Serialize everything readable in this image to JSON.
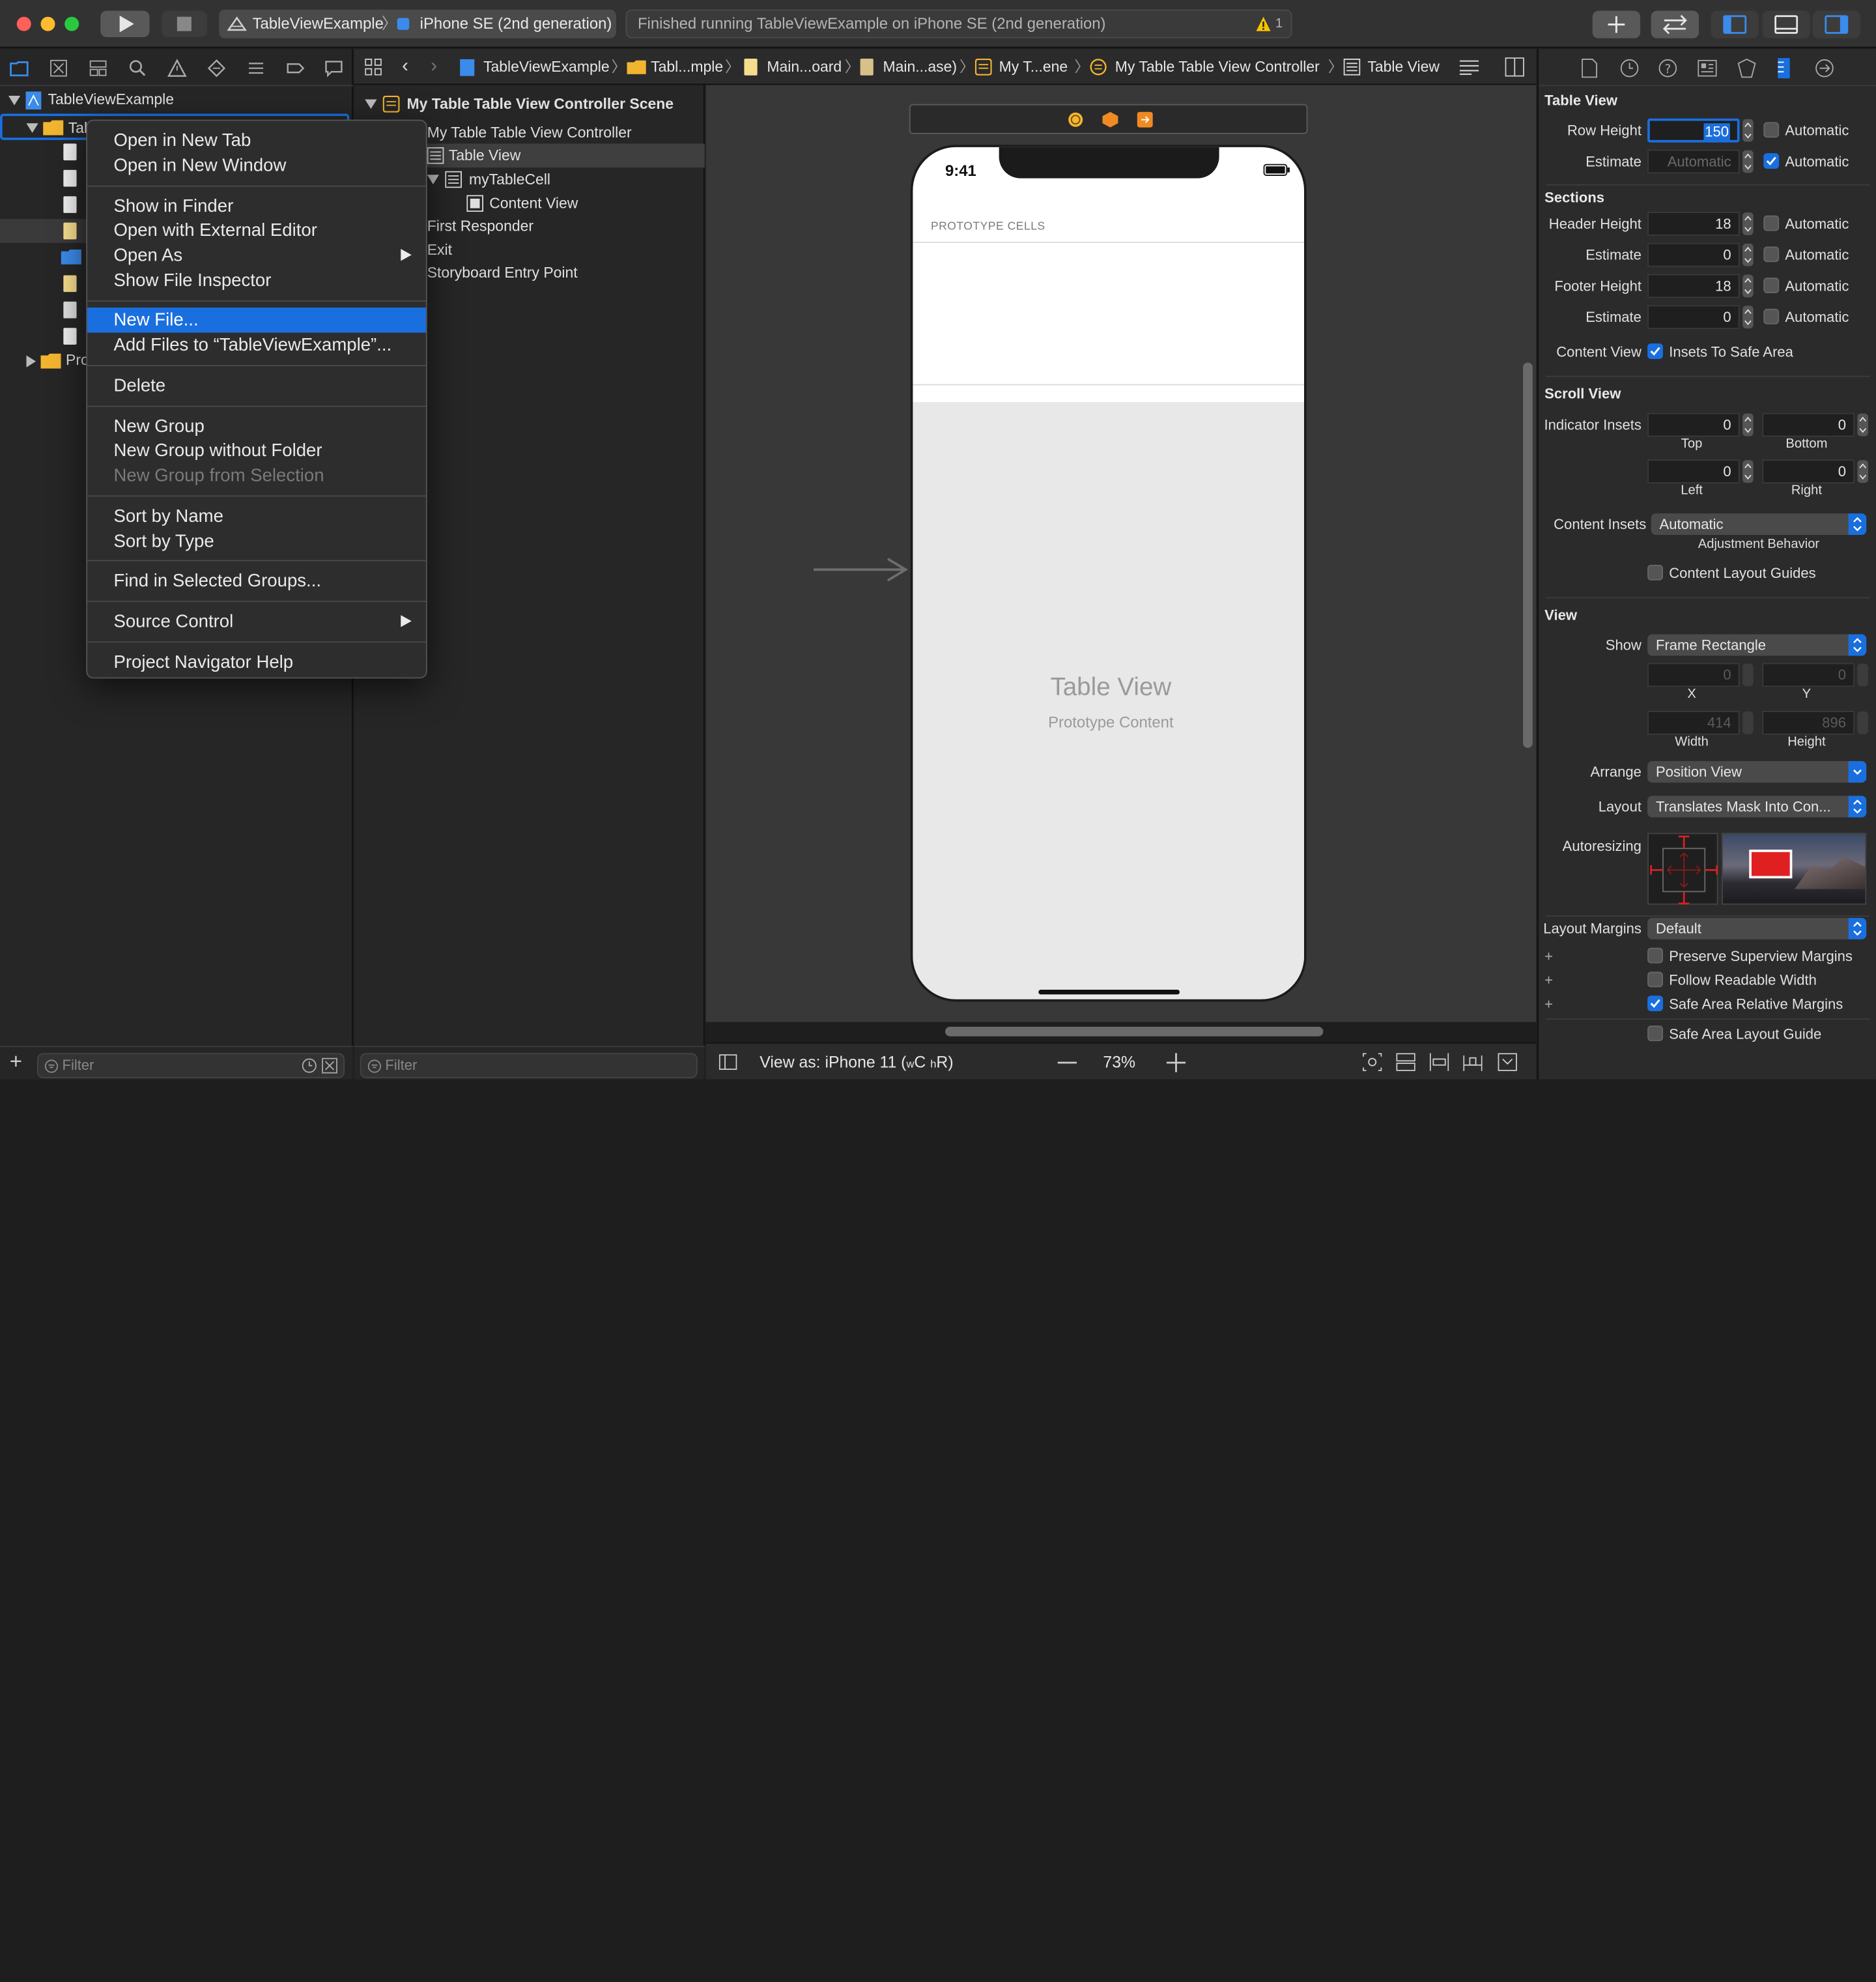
{
  "window": {
    "scheme_project": "TableViewExample",
    "scheme_device": "iPhone SE (2nd generation)",
    "activity_text": "Finished running TableViewExample on iPhone SE (2nd generation)",
    "warning_count": "1"
  },
  "navigator": {
    "project_name": "TableViewExample",
    "group_partial": "Tabl",
    "products_partial": "Pro",
    "filter_placeholder": "Filter"
  },
  "jumpbar": {
    "crumbs": [
      "TableViewExample",
      "Tabl...mple",
      "Main...oard",
      "Main...ase)",
      "My T...ene",
      "My Table Table View Controller",
      "Table View"
    ]
  },
  "outline": {
    "scene": "My Table Table View Controller Scene",
    "controller": "My Table Table View Controller",
    "table_view": "Table View",
    "cell": "myTableCell",
    "content_view": "Content View",
    "first_responder": "First Responder",
    "exit": "Exit",
    "entry_point": "Storyboard Entry Point",
    "filter_placeholder": "Filter"
  },
  "canvas": {
    "status_time": "9:41",
    "prototype_cells": "PROTOTYPE CELLS",
    "table_view_title": "Table View",
    "prototype_content": "Prototype Content"
  },
  "bottombar": {
    "view_as": "View as: iPhone 11 (",
    "size_w": "w",
    "size_c": "C",
    "size_h": "h",
    "size_r": "R)",
    "zoom": "73%"
  },
  "context_menu": {
    "groups": [
      [
        {
          "label": "Open in New Tab"
        },
        {
          "label": "Open in New Window"
        }
      ],
      [
        {
          "label": "Show in Finder"
        },
        {
          "label": "Open with External Editor"
        },
        {
          "label": "Open As"
        },
        {
          "label": "Show File Inspector"
        }
      ],
      [
        {
          "label": "New File..."
        },
        {
          "label": "Add Files to “TableViewExample”..."
        }
      ],
      [
        {
          "label": "Delete"
        }
      ],
      [
        {
          "label": "New Group"
        },
        {
          "label": "New Group without Folder"
        },
        {
          "label": "New Group from Selection"
        }
      ],
      [
        {
          "label": "Sort by Name"
        },
        {
          "label": "Sort by Type"
        }
      ],
      [
        {
          "label": "Find in Selected Groups..."
        }
      ],
      [
        {
          "label": "Source Control"
        }
      ],
      [
        {
          "label": "Project Navigator Help"
        }
      ]
    ]
  },
  "inspector": {
    "table_view_header": "Table View",
    "row_height_label": "Row Height",
    "row_height_value": "150",
    "automatic": "Automatic",
    "estimate_label": "Estimate",
    "estimate_placeholder": "Automatic",
    "sections_header": "Sections",
    "header_height_label": "Header Height",
    "header_height_value": "18",
    "header_estimate_value": "0",
    "footer_height_label": "Footer Height",
    "footer_height_value": "18",
    "footer_estimate_value": "0",
    "content_view_label": "Content View",
    "insets_safe_area": "Insets To Safe Area",
    "scroll_view_header": "Scroll View",
    "indicator_insets_label": "Indicator Insets",
    "top_value": "0",
    "bottom_value": "0",
    "left_value": "0",
    "right_value": "0",
    "top": "Top",
    "bottom": "Bottom",
    "left": "Left",
    "right": "Right",
    "content_insets_label": "Content Insets",
    "content_insets_value": "Automatic",
    "adjustment_behavior": "Adjustment Behavior",
    "content_layout_guides": "Content Layout Guides",
    "view_header": "View",
    "show_label": "Show",
    "show_value": "Frame Rectangle",
    "x_value": "0",
    "y_value": "0",
    "x": "X",
    "y": "Y",
    "width_value": "414",
    "height_value": "896",
    "width": "Width",
    "height": "Height",
    "arrange_label": "Arrange",
    "arrange_value": "Position View",
    "layout_label": "Layout",
    "layout_value": "Translates Mask Into Con...",
    "autoresizing_label": "Autoresizing",
    "layout_margins_label": "Layout Margins",
    "layout_margins_value": "Default",
    "preserve_margins": "Preserve Superview Margins",
    "follow_readable": "Follow Readable Width",
    "safe_area_relative": "Safe Area Relative Margins",
    "safe_area_guide": "Safe Area Layout Guide"
  },
  "colors": {
    "accent": "#1a6fdf",
    "selection": "#1a6fdf",
    "warning": "#f5c400",
    "autoresizing_red": "#e02020"
  }
}
